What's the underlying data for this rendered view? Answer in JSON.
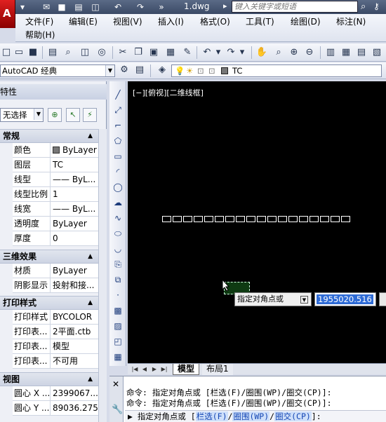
{
  "titlebar": {
    "file_title": "1.dwg",
    "search_placeholder": "键入关键字或短语"
  },
  "menu": {
    "row1": [
      "文件(F)",
      "编辑(E)",
      "视图(V)",
      "插入(I)",
      "格式(O)",
      "工具(T)",
      "绘图(D)",
      "标注(N)"
    ],
    "row2": [
      "帮助(H)"
    ]
  },
  "workspace": {
    "selected": "AutoCAD 经典"
  },
  "layer": {
    "current": "TC"
  },
  "properties": {
    "title": "特性",
    "selection": "无选择",
    "sections": {
      "general": {
        "label": "常规",
        "rows": [
          {
            "key": "颜色",
            "value": "ByLayer"
          },
          {
            "key": "图层",
            "value": "TC"
          },
          {
            "key": "线型",
            "value": "—— ByL..."
          },
          {
            "key": "线型比例",
            "value": "1"
          },
          {
            "key": "线宽",
            "value": "—— ByL..."
          },
          {
            "key": "透明度",
            "value": "ByLayer"
          },
          {
            "key": "厚度",
            "value": "0"
          }
        ]
      },
      "three_d": {
        "label": "三维效果",
        "rows": [
          {
            "key": "材质",
            "value": "ByLayer"
          },
          {
            "key": "阴影显示",
            "value": "投射和接..."
          }
        ]
      },
      "plot": {
        "label": "打印样式",
        "rows": [
          {
            "key": "打印样式",
            "value": "BYCOLOR"
          },
          {
            "key": "打印表...",
            "value": "2平面.ctb"
          },
          {
            "key": "打印表...",
            "value": "模型"
          },
          {
            "key": "打印表...",
            "value": "不可用"
          }
        ]
      },
      "view": {
        "label": "视图",
        "rows": [
          {
            "key": "圆心 X ...",
            "value": "2399067...."
          },
          {
            "key": "圆心 Y ...",
            "value": "89036.275"
          }
        ]
      }
    }
  },
  "canvas": {
    "view_label": "[−][俯视][二维线框]",
    "prompt": "指定对角点或",
    "coord_value": "1955020.516"
  },
  "layout_tabs": [
    "模型",
    "布局1"
  ],
  "command": {
    "history": [
      "命令: 指定对角点或 [栏选(F)/圈围(WP)/圈交(CP)]:",
      "命令: 指定对角点或 [栏选(F)/圈围(WP)/圈交(CP)]:"
    ],
    "input_prefix": "指定对角点或 [",
    "options": [
      "栏选(F)",
      "圈围(WP)",
      "圈交(CP)"
    ],
    "input_suffix": "]:"
  }
}
